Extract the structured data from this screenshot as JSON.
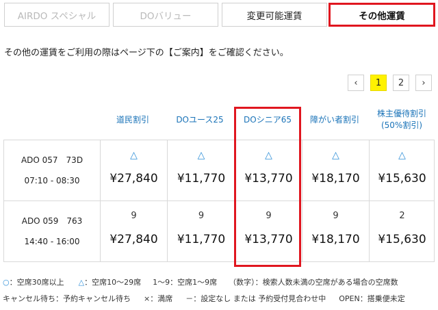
{
  "tabs": [
    {
      "label": "AIRDO スペシャル",
      "state": "disabled"
    },
    {
      "label": "DOバリュー",
      "state": "disabled"
    },
    {
      "label": "変更可能運賃",
      "state": "normal"
    },
    {
      "label": "その他運賃",
      "state": "active"
    }
  ],
  "notice": "その他の運賃をご利用の際はページ下の【ご案内】をご確認ください。",
  "pagination": {
    "prev": "‹",
    "pages": [
      "1",
      "2"
    ],
    "current": "1",
    "next": "›"
  },
  "columns": [
    "道民割引",
    "DOユース25",
    "DOシニア65",
    "障がい者割引",
    "株主優待割引\n(50%割引)"
  ],
  "flights": [
    {
      "flight": "ADO 057　73D",
      "time": "07:10 - 08:30",
      "seats": [
        "△",
        "△",
        "△",
        "△",
        "△"
      ],
      "prices": [
        "¥27,840",
        "¥11,770",
        "¥13,770",
        "¥18,170",
        "¥15,630"
      ]
    },
    {
      "flight": "ADO 059　763",
      "time": "14:40 - 16:00",
      "seats": [
        "9",
        "9",
        "9",
        "9",
        "2"
      ],
      "prices": [
        "¥27,840",
        "¥11,770",
        "¥13,770",
        "¥18,170",
        "¥15,630"
      ]
    }
  ],
  "legend": {
    "line1": {
      "circle_mark": "○",
      "circle_text": "：空席30席以上",
      "triangle_mark": "△",
      "triangle_text": "：空席10～29席",
      "few": "1～9：空席1～9席",
      "number": "（数字）：検索人数未満の空席がある場合の空席数"
    },
    "line2": {
      "cancel": "キャンセル待ち：予約キャンセル待ち",
      "full": "×：満席",
      "none": "－：設定なし または 予約受付見合わせ中",
      "open": "OPEN：搭乗便未定"
    }
  },
  "colors": {
    "accent": "#e0161f",
    "link": "#1a73b8",
    "seat_mark": "#2f8fd8",
    "current_page": "#fff200"
  }
}
